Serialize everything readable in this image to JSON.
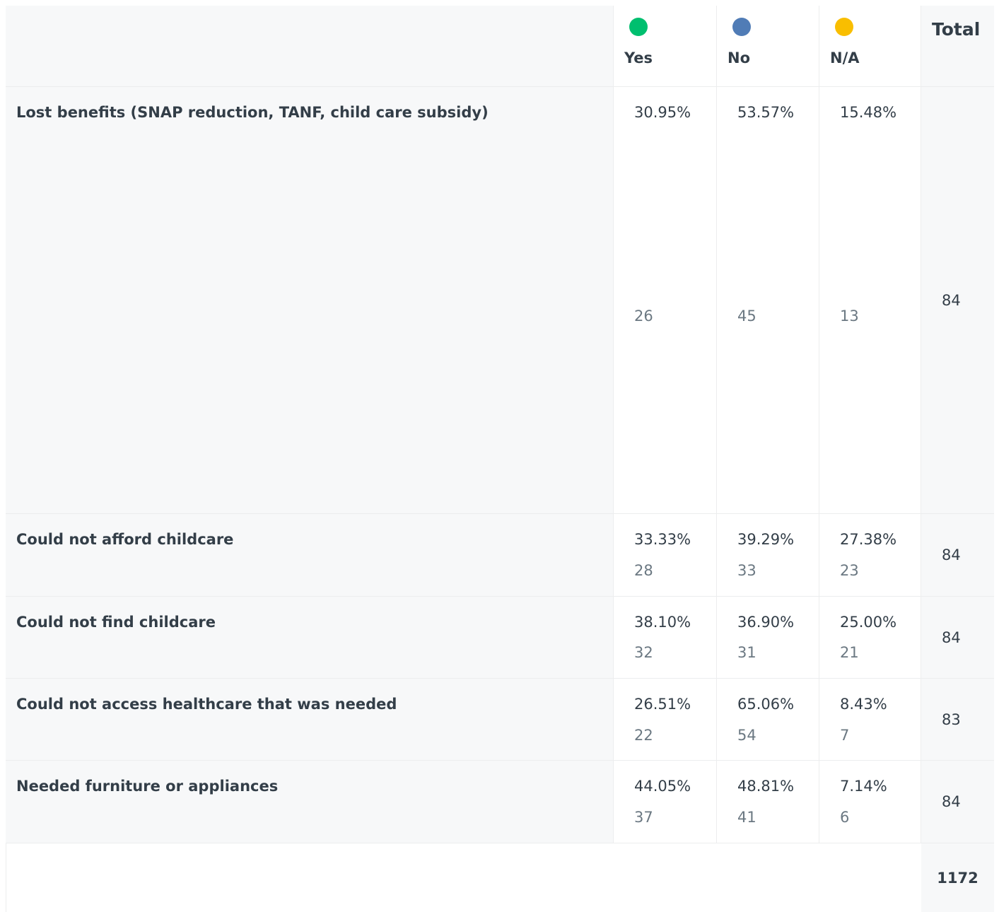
{
  "columns": [
    {
      "label": "Yes",
      "color": "#00bf6f"
    },
    {
      "label": "No",
      "color": "#507cb6"
    },
    {
      "label": "N/A",
      "color": "#f9be00"
    }
  ],
  "total_header": "Total",
  "rows": [
    {
      "label": "Lost benefits (SNAP reduction, TANF, child care subsidy)",
      "cells": [
        {
          "pct": "30.95%",
          "count": "26"
        },
        {
          "pct": "53.57%",
          "count": "45"
        },
        {
          "pct": "15.48%",
          "count": "13"
        }
      ],
      "total": "84"
    },
    {
      "label": "Could not afford childcare",
      "cells": [
        {
          "pct": "33.33%",
          "count": "28"
        },
        {
          "pct": "39.29%",
          "count": "33"
        },
        {
          "pct": "27.38%",
          "count": "23"
        }
      ],
      "total": "84"
    },
    {
      "label": "Could not find childcare",
      "cells": [
        {
          "pct": "38.10%",
          "count": "32"
        },
        {
          "pct": "36.90%",
          "count": "31"
        },
        {
          "pct": "25.00%",
          "count": "21"
        }
      ],
      "total": "84"
    },
    {
      "label": "Could not access healthcare that was needed",
      "cells": [
        {
          "pct": "26.51%",
          "count": "22"
        },
        {
          "pct": "65.06%",
          "count": "54"
        },
        {
          "pct": "8.43%",
          "count": "7"
        }
      ],
      "total": "83"
    },
    {
      "label": "Needed furniture or appliances",
      "cells": [
        {
          "pct": "44.05%",
          "count": "37"
        },
        {
          "pct": "48.81%",
          "count": "41"
        },
        {
          "pct": "7.14%",
          "count": "6"
        }
      ],
      "total": "84"
    }
  ],
  "grand_total": "1172"
}
